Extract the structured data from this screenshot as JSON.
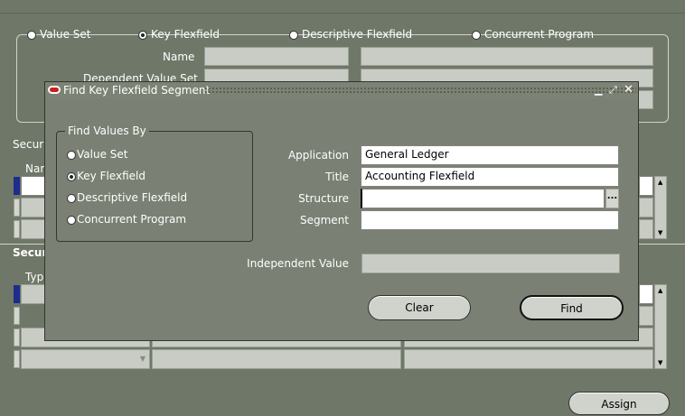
{
  "background_form": {
    "radio_options": [
      {
        "label": "Value Set",
        "selected": false
      },
      {
        "label": "Key Flexfield",
        "selected": true
      },
      {
        "label": "Descriptive Flexfield",
        "selected": false
      },
      {
        "label": "Concurrent Program",
        "selected": false
      }
    ],
    "name_label": "Name",
    "dependent_label": "Dependent Value Set",
    "section1_label": "Secur",
    "section1_col": "Nar",
    "section2_label": "Secur",
    "section2_col": "Typ",
    "assign_button": "Assign"
  },
  "dialog": {
    "title": "Find Key Flexfield Segment",
    "group_title": "Find Values By",
    "options": [
      {
        "label": "Value Set",
        "selected": false
      },
      {
        "label": "Key Flexfield",
        "selected": true
      },
      {
        "label": "Descriptive Flexfield",
        "selected": false
      },
      {
        "label": "Concurrent Program",
        "selected": false
      }
    ],
    "fields": {
      "application_label": "Application",
      "application_value": "General Ledger",
      "title_label": "Title",
      "title_value": "Accounting Flexfield",
      "structure_label": "Structure",
      "structure_value": "",
      "segment_label": "Segment",
      "segment_value": "",
      "independent_label": "Independent Value",
      "independent_value": ""
    },
    "lov_button": "...",
    "clear_button": "Clear",
    "find_button": "Find"
  },
  "colors": {
    "background": "#6f7868",
    "dialog_body": "#7a8073",
    "oracle_red": "#cc1f1f"
  }
}
